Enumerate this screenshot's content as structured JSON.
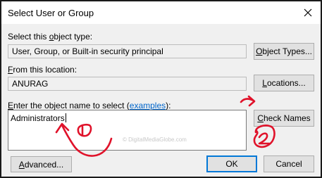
{
  "window": {
    "title": "Select User or Group",
    "close_glyph": "×"
  },
  "object_type": {
    "label_prefix": "Select this ",
    "label_mnemonic": "o",
    "label_suffix": "bject type:",
    "value": "User, Group, or Built-in security principal",
    "button_prefix": "",
    "button_mnemonic": "O",
    "button_suffix": "bject Types..."
  },
  "location": {
    "label_prefix": "",
    "label_mnemonic": "F",
    "label_suffix": "rom this location:",
    "value": "ANURAG",
    "button_prefix": "",
    "button_mnemonic": "L",
    "button_suffix": "ocations..."
  },
  "object_name": {
    "label_prefix": "",
    "label_mnemonic": "E",
    "label_suffix": "nter the object name to select (",
    "examples_link": "examples",
    "label_end": "):",
    "value": "Administrators",
    "check_prefix": "",
    "check_mnemonic": "C",
    "check_suffix": "heck Names"
  },
  "footer": {
    "advanced_prefix": "",
    "advanced_mnemonic": "A",
    "advanced_suffix": "dvanced...",
    "ok_label": "OK",
    "cancel_label": "Cancel"
  },
  "watermark": "© DigitalMediaGlobe.com",
  "annotations": {
    "color": "#e0122a",
    "step1": "1",
    "step2": "2"
  }
}
